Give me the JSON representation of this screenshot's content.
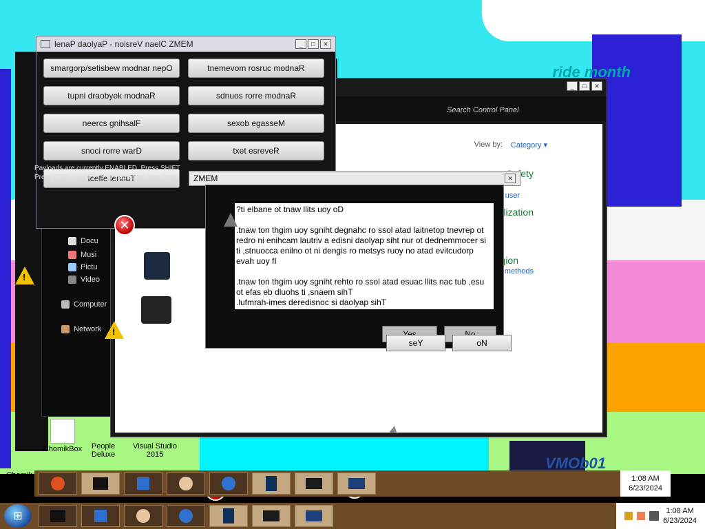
{
  "background_text": {
    "ride_month": "ride month",
    "vm": "VMOb01"
  },
  "memz_main": {
    "title": "lenaP daolyaP - noisreV naelC ZMEM",
    "payloads": [
      {
        "label": "smargorp/setisbew modnar nepO"
      },
      {
        "label": "tnemevom rosruc modnaR"
      },
      {
        "label": "tupni draobyek modnaR"
      },
      {
        "label": "sdnuos rorre modnaR"
      },
      {
        "label": "neercs gnihsalF"
      },
      {
        "label": "sexob egasseM"
      },
      {
        "label": "snoci rorre warD"
      },
      {
        "label": "txet esreveR"
      },
      {
        "label": "tceffe lennuT"
      }
    ],
    "info_line1": "Payloads are currently ENABLED. Press SHIFT",
    "info_line2": "Press CTRL+SHIFT+S to skip some time (mak"
  },
  "control_panel": {
    "search_placeholder": "Search Control Panel",
    "view_by": "View by:",
    "category": "Category ▾",
    "links": [
      "Safety",
      "lization",
      "gion"
    ],
    "sublinks": [
      "ny user",
      "c methods"
    ]
  },
  "explorer": {
    "items": [
      "Docu",
      "Musi",
      "Pictu",
      "Video",
      "Computer",
      "Network"
    ]
  },
  "dialog": {
    "title": "ZMEM",
    "message": "?ti elbane ot tnaw llits uoy oD\n\n.tnaw ton thgim uoy sgniht degnahc ro ssol atad laitnetop tnevrep ot redro ni enihcam lautriv a edisni daolyap siht nur ot dednemmocer si ti ,stnuocca enilno ot ni dengis ro metsys ruoy no atad evitcudorp evah uoy fI\n\n.tnaw ton thgim uoy sgniht rehto ro ssol atad esuac llits nac tub ,esu ot efas eb dluohs ti ,snaem sihT\n.lufmrah-imes deredisnoc si daolyap sihT",
    "yes_label": "seY",
    "no_label": "oN",
    "ghost_yes": "Yes",
    "ghost_no": "No"
  },
  "desktop_icons": [
    {
      "label": "ChomikBox"
    },
    {
      "label": "People Deluxe"
    },
    {
      "label": "Visual Studio 2015"
    },
    {
      "label": "Chomik"
    }
  ],
  "taskbar": {
    "time": "1:08 AM",
    "date": "6/23/2024"
  }
}
